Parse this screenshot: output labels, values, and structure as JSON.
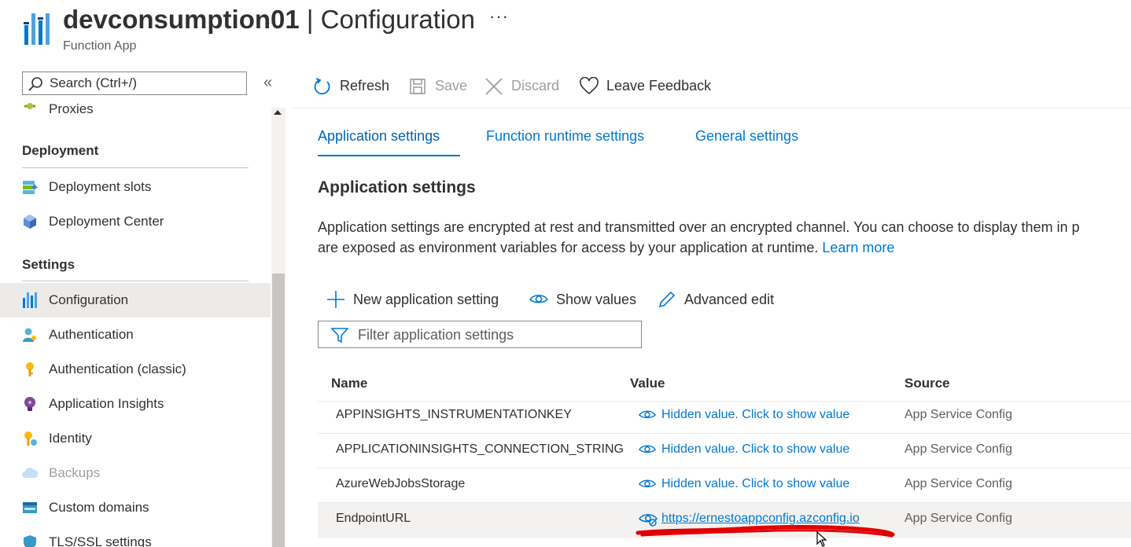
{
  "header": {
    "resource_name": "devconsumption01",
    "separator": " | ",
    "page_name": "Configuration",
    "subtitle": "Function App",
    "more_label": "···"
  },
  "sidebar": {
    "search_placeholder": "Search (Ctrl+/)",
    "collapse_label": "«",
    "items_top": [
      {
        "label": "Proxies",
        "icon": "proxies-icon"
      }
    ],
    "sections": [
      {
        "title": "Deployment",
        "items": [
          {
            "label": "Deployment slots",
            "icon": "deployment-slots-icon"
          },
          {
            "label": "Deployment Center",
            "icon": "deployment-center-icon"
          }
        ]
      },
      {
        "title": "Settings",
        "items": [
          {
            "label": "Configuration",
            "icon": "configuration-icon",
            "active": true
          },
          {
            "label": "Authentication",
            "icon": "authentication-icon"
          },
          {
            "label": "Authentication (classic)",
            "icon": "key-icon"
          },
          {
            "label": "Application Insights",
            "icon": "lightbulb-icon"
          },
          {
            "label": "Identity",
            "icon": "identity-icon"
          },
          {
            "label": "Backups",
            "icon": "backups-icon",
            "disabled": true
          },
          {
            "label": "Custom domains",
            "icon": "custom-domains-icon"
          },
          {
            "label": "TLS/SSL settings",
            "icon": "shield-icon"
          }
        ]
      }
    ]
  },
  "toolbar": {
    "refresh": "Refresh",
    "save": "Save",
    "discard": "Discard",
    "feedback": "Leave Feedback"
  },
  "tabs": [
    "Application settings",
    "Function runtime settings",
    "General settings"
  ],
  "content": {
    "title": "Application settings",
    "description_line1": "Application settings are encrypted at rest and transmitted over an encrypted channel. You can choose to display them in p",
    "description_line2": "are exposed as environment variables for access by your application at runtime.",
    "learn_more": "Learn more"
  },
  "actions": {
    "new_setting": "New application setting",
    "show_values": "Show values",
    "advanced_edit": "Advanced edit",
    "filter_placeholder": "Filter application settings"
  },
  "table": {
    "columns": [
      "Name",
      "Value",
      "Source"
    ],
    "rows": [
      {
        "name": "APPINSIGHTS_INSTRUMENTATIONKEY",
        "value": "Hidden value. Click to show value",
        "source": "App Service Config"
      },
      {
        "name": "APPLICATIONINSIGHTS_CONNECTION_STRING",
        "value": "Hidden value. Click to show value",
        "source": "App Service Config"
      },
      {
        "name": "AzureWebJobsStorage",
        "value": "Hidden value. Click to show value",
        "source": "App Service Config"
      },
      {
        "name": "EndpointURL",
        "value": "https://ernestoappconfig.azconfig.io",
        "source": "App Service Config"
      }
    ]
  },
  "colors": {
    "accent": "#0078d4",
    "annotation": "#e00000",
    "selected_bg": "#edebe9"
  }
}
